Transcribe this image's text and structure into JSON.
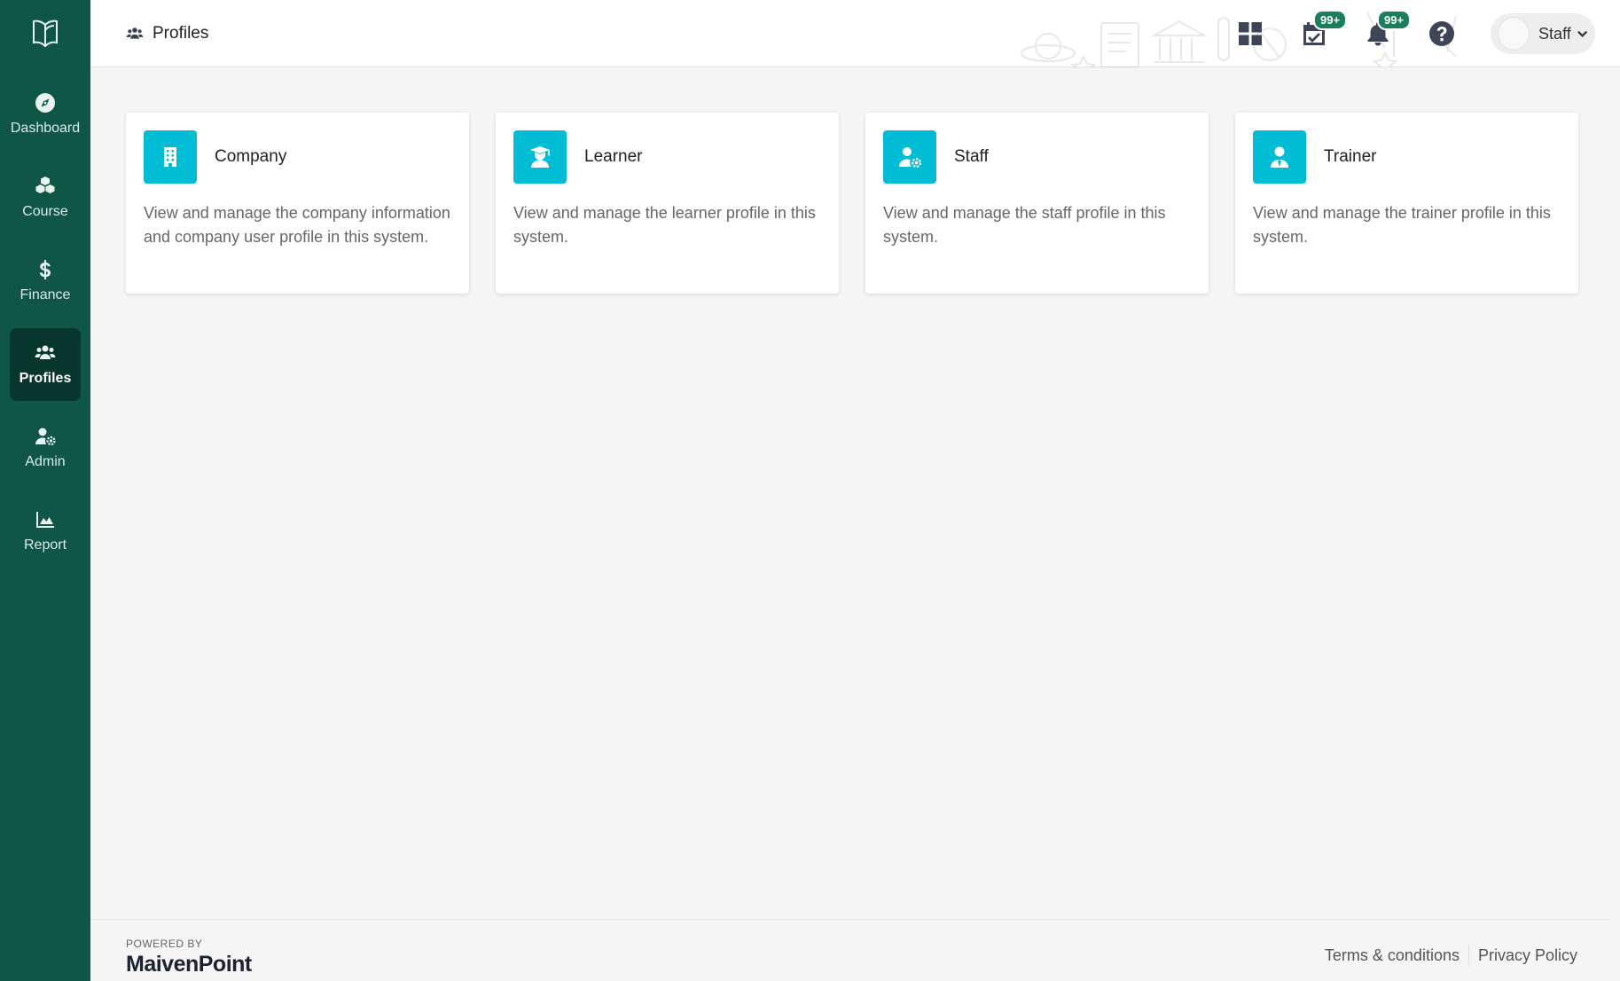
{
  "sidebar": {
    "logo_icon": "open-book-icon",
    "items": [
      {
        "label": "Dashboard",
        "icon": "compass-icon",
        "active": false
      },
      {
        "label": "Course",
        "icon": "cubes-icon",
        "active": false
      },
      {
        "label": "Finance",
        "icon": "dollar-icon",
        "active": false
      },
      {
        "label": "Profiles",
        "icon": "users-icon",
        "active": true
      },
      {
        "label": "Admin",
        "icon": "user-gear-icon",
        "active": false
      },
      {
        "label": "Report",
        "icon": "area-chart-icon",
        "active": false
      }
    ]
  },
  "header": {
    "title": "Profiles",
    "title_icon": "users-icon",
    "apps_icon": "grid-icon",
    "tasks_badge": "99+",
    "notifications_badge": "99+",
    "help_icon": "question-circle-icon",
    "user_name": "Staff"
  },
  "cards": [
    {
      "title": "Company",
      "icon": "building-icon",
      "description": "View and manage the company information and company user profile in this system."
    },
    {
      "title": "Learner",
      "icon": "graduate-icon",
      "description": "View and manage the learner profile in this system."
    },
    {
      "title": "Staff",
      "icon": "user-gear-icon",
      "description": "View and manage the staff profile in this system."
    },
    {
      "title": "Trainer",
      "icon": "user-tie-icon",
      "description": "View and manage the trainer profile in this system."
    }
  ],
  "footer": {
    "powered_by": "POWERED BY",
    "brand": "MaivenPoint",
    "terms": "Terms & conditions",
    "privacy": "Privacy Policy"
  },
  "colors": {
    "sidebar_bg": "#0f5646",
    "sidebar_active": "#07372c",
    "card_icon_bg": "#00bcd4",
    "badge_bg": "#1a7f5a"
  }
}
